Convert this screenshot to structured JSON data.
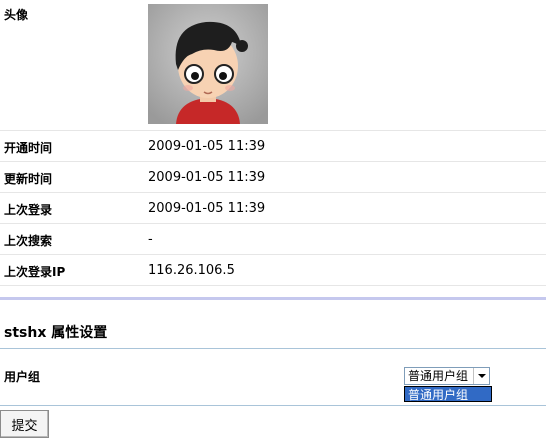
{
  "profile": {
    "avatar_label": "头像",
    "rows": [
      {
        "label": "开通时间",
        "value": "2009-01-05 11:39"
      },
      {
        "label": "更新时间",
        "value": "2009-01-05 11:39"
      },
      {
        "label": "上次登录",
        "value": "2009-01-05 11:39"
      },
      {
        "label": "上次搜索",
        "value": "-"
      },
      {
        "label": "上次登录IP",
        "value": "116.26.106.5"
      }
    ]
  },
  "settings": {
    "title": "stshx 属性设置",
    "user_group_label": "用户组",
    "user_group_selected": "普通用户组",
    "user_group_options": [
      "普通用户组"
    ]
  },
  "actions": {
    "submit_label": "提交"
  },
  "colors": {
    "separator_accent": "#c5c8ee",
    "dropdown_highlight": "#316ac5"
  },
  "icons": {
    "avatar": "cartoon-face-avatar",
    "select_arrow": "chevron-down-icon"
  }
}
